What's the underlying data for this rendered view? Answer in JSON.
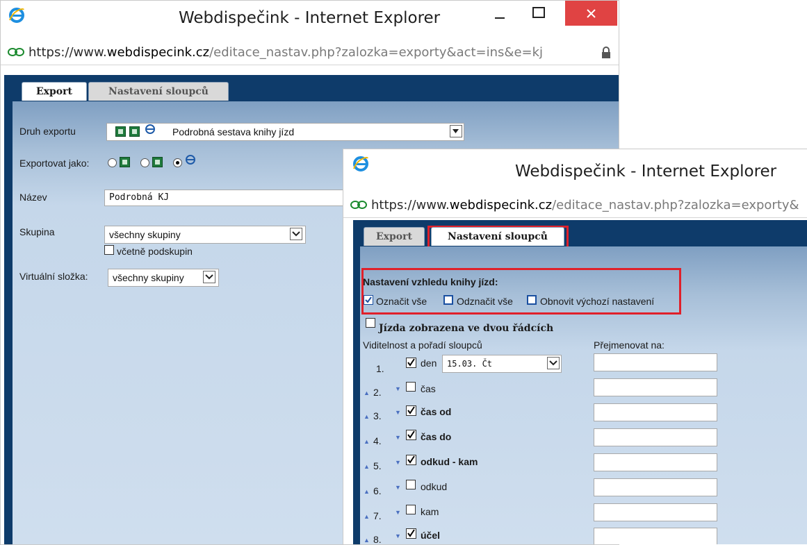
{
  "back_window": {
    "title": "Webdispečink - Internet Explorer",
    "url_proto": "https://www.",
    "url_host": "webdispecink.cz",
    "url_path": "/editace_nastav.php?zalozka=exporty&act=ins&e=kj",
    "tabs": [
      "Export",
      "Nastavení sloupců"
    ],
    "form": {
      "druh_label": "Druh exportu",
      "druh_value": "Podrobná sestava knihy jízd",
      "exportovat_label": "Exportovat jako:",
      "format_options": [
        "xls",
        "csv",
        "html"
      ],
      "format_selected": "html",
      "nazev_label": "Název",
      "nazev_value": "Podrobná KJ",
      "skupina_label": "Skupina",
      "skupina_value": "všechny skupiny",
      "podskupin_label": "včetně podskupin",
      "virtual_label": "Virtuální složka:",
      "virtual_value": "všechny skupiny"
    }
  },
  "front_window": {
    "title": "Webdispečink - Internet Explorer",
    "url_proto": "https://www.",
    "url_host": "webdispecink.cz",
    "url_path": "/editace_nastav.php?zalozka=exporty&",
    "tabs": [
      "Export",
      "Nastavení sloupců"
    ],
    "settings_heading": "Nastavení vzhledu knihy jízd:",
    "select_all": "Označit vše",
    "deselect_all": "Odznačit vše",
    "restore_defaults": "Obnovit výchozí nastavení",
    "two_rows_label": "Jízda zobrazena ve dvou řádcích",
    "visibility_header": "Viditelnost a pořadí sloupců",
    "rename_header": "Přejmenovat na:",
    "den_format": "15.03. Čt",
    "columns": [
      {
        "num": "1.",
        "name": "den",
        "checked": true
      },
      {
        "num": "2.",
        "name": "čas",
        "checked": false
      },
      {
        "num": "3.",
        "name": "čas od",
        "checked": true
      },
      {
        "num": "4.",
        "name": "čas do",
        "checked": true
      },
      {
        "num": "5.",
        "name": "odkud - kam",
        "checked": true
      },
      {
        "num": "6.",
        "name": "odkud",
        "checked": false
      },
      {
        "num": "7.",
        "name": "kam",
        "checked": false
      },
      {
        "num": "8.",
        "name": "účel",
        "checked": true
      }
    ]
  },
  "colors": {
    "app_dark_blue": "#0e3b6a",
    "highlight_red": "#e0202a",
    "close_red": "#e04343"
  }
}
